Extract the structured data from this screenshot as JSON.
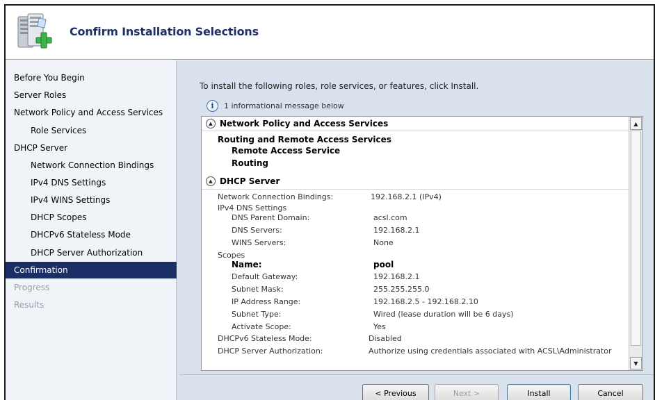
{
  "header": {
    "title": "Confirm Installation Selections",
    "icon": "server-add-icon"
  },
  "sidebar": {
    "items": [
      {
        "label": "Before You Begin",
        "level": 0,
        "state": "normal"
      },
      {
        "label": "Server Roles",
        "level": 0,
        "state": "normal"
      },
      {
        "label": "Network Policy and Access Services",
        "level": 0,
        "state": "normal"
      },
      {
        "label": "Role Services",
        "level": 1,
        "state": "normal"
      },
      {
        "label": "DHCP Server",
        "level": 0,
        "state": "normal"
      },
      {
        "label": "Network Connection Bindings",
        "level": 1,
        "state": "normal"
      },
      {
        "label": "IPv4 DNS Settings",
        "level": 1,
        "state": "normal"
      },
      {
        "label": "IPv4 WINS Settings",
        "level": 1,
        "state": "normal"
      },
      {
        "label": "DHCP Scopes",
        "level": 1,
        "state": "normal"
      },
      {
        "label": "DHCPv6 Stateless Mode",
        "level": 1,
        "state": "normal"
      },
      {
        "label": "DHCP Server Authorization",
        "level": 1,
        "state": "normal"
      },
      {
        "label": "Confirmation",
        "level": 0,
        "state": "selected"
      },
      {
        "label": "Progress",
        "level": 0,
        "state": "disabled"
      },
      {
        "label": "Results",
        "level": 0,
        "state": "disabled"
      }
    ]
  },
  "content": {
    "intro": "To install the following roles, role services, or features, click Install.",
    "info_message": "1 informational message below",
    "info_icon": "info-icon"
  },
  "details": {
    "npas": {
      "header": "Network Policy and Access Services",
      "service": "Routing and Remote Access Services",
      "sub1": "Remote Access Service",
      "sub2": "Routing"
    },
    "dhcp": {
      "header": "DHCP Server",
      "rows": [
        {
          "label": "Network Connection Bindings:",
          "value": "192.168.2.1 (IPv4)"
        },
        {
          "label": "IPv4 DNS Settings",
          "value": ""
        },
        {
          "label": "DNS Parent Domain:",
          "value": "acsl.com"
        },
        {
          "label": "DNS Servers:",
          "value": "192.168.2.1"
        },
        {
          "label": "WINS Servers:",
          "value": "None"
        },
        {
          "label": "Scopes",
          "value": ""
        },
        {
          "label": "Name:",
          "value": "pool"
        },
        {
          "label": "Default Gateway:",
          "value": "192.168.2.1"
        },
        {
          "label": "Subnet Mask:",
          "value": "255.255.255.0"
        },
        {
          "label": "IP Address Range:",
          "value": "192.168.2.5 - 192.168.2.10"
        },
        {
          "label": "Subnet Type:",
          "value": "Wired (lease duration will be 6 days)"
        },
        {
          "label": "Activate Scope:",
          "value": "Yes"
        },
        {
          "label": "DHCPv6 Stateless Mode:",
          "value": "Disabled"
        },
        {
          "label": "DHCP Server Authorization:",
          "value": "Authorize using credentials associated with ACSL\\Administrator"
        }
      ]
    }
  },
  "buttons": {
    "previous": "< Previous",
    "next": "Next >",
    "install": "Install",
    "cancel": "Cancel"
  },
  "colors": {
    "selected_nav": "#1c2e66",
    "content_bg": "#d8e1ec",
    "title": "#1f3166"
  }
}
